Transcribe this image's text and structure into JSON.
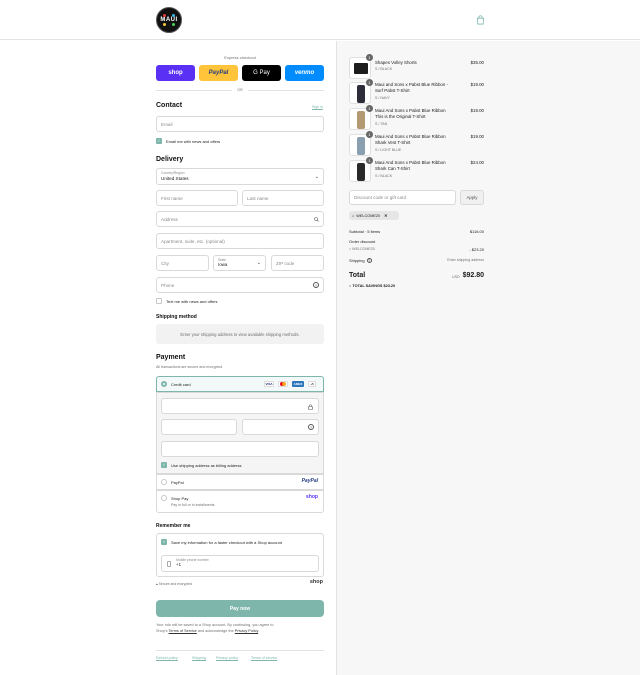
{
  "header": {
    "logo_text": "MAUI",
    "bag_icon": "shopping-bag-icon"
  },
  "express": {
    "title": "Express checkout",
    "shop_label": "shop",
    "paypal_label": "PayPal",
    "gpay_label": "G Pay",
    "venmo_label": "venmo",
    "or_label": "OR"
  },
  "contact": {
    "title": "Contact",
    "signin_label": "Sign in",
    "email_placeholder": "Email",
    "news_label": "Email me with news and offers"
  },
  "delivery": {
    "title": "Delivery",
    "country_label": "Country/Region",
    "country_value": "United States",
    "first_name_placeholder": "First name",
    "last_name_placeholder": "Last name",
    "address_placeholder": "Address",
    "apartment_placeholder": "Apartment, suite, etc. (optional)",
    "city_placeholder": "City",
    "state_label": "State",
    "state_value": "Iowa",
    "zip_placeholder": "ZIP code",
    "phone_placeholder": "Phone",
    "text_news_label": "Text me with news and offers"
  },
  "shipping": {
    "title": "Shipping method",
    "message": "Enter your shipping address to view available shipping methods."
  },
  "payment": {
    "title": "Payment",
    "subtitle": "All transactions are secure and encrypted.",
    "credit_card_label": "Credit card",
    "card_brands": [
      "VISA",
      "MC",
      "AMEX",
      "+5"
    ],
    "billing_label": "Use shipping address as billing address",
    "paypal_label": "PayPal",
    "paypal_logo": "PayPal",
    "shoppay_label": "Shop Pay",
    "shoppay_sub": "Pay in full or in installments",
    "shoppay_logo": "shop"
  },
  "remember": {
    "title": "Remember me",
    "save_label": "Save my information for a faster checkout with a Shop account",
    "phone_label": "Mobile phone number",
    "phone_value": "+1",
    "secure_label": "Secure and encrypted",
    "shop_logo": "shop"
  },
  "pay_button": "Pay now",
  "legal": {
    "line1": "Your info will be saved to a Shop account. By continuing, you agree to",
    "line2_prefix": "Shop's",
    "terms": "Terms of Service",
    "and_text": "and acknowledge the",
    "privacy": "Privacy Policy",
    "end": "."
  },
  "footer_links": [
    "Refund policy",
    "Shipping",
    "Privacy policy",
    "Terms of service"
  ],
  "summary": {
    "products": [
      {
        "qty": "1",
        "name": [
          "Shapes Volley Shorts"
        ],
        "variant": "S / BLACK",
        "price": "$35.00"
      },
      {
        "qty": "1",
        "name": [
          "Maui and Sons x Pabst Blue Ribbon -",
          "Surf Pabst T-Shirt"
        ],
        "variant": "S / NAVY",
        "price": "$19.00"
      },
      {
        "qty": "1",
        "name": [
          "Maui And Sons x Pabst Blue Ribbon",
          "This is the Original T-Shirt"
        ],
        "variant": "S / TAN",
        "price": "$19.00"
      },
      {
        "qty": "1",
        "name": [
          "Maui And Sons x Pabst Blue Ribbon",
          "Shark Vest T-Shirt"
        ],
        "variant": "S / LIGHT BLUE",
        "price": "$19.00"
      },
      {
        "qty": "1",
        "name": [
          "Maui And Sons x Pabst Blue Ribbon",
          "Shark Can T-Shirt"
        ],
        "variant": "S / BLACK",
        "price": "$24.00"
      }
    ],
    "discount_placeholder": "Discount code or gift card",
    "apply_label": "Apply",
    "code_tag": "WELCOME20",
    "subtotal_label": "Subtotal · 5 items",
    "subtotal_value": "$116.00",
    "order_discount_label": "Order discount",
    "discount_code": "WELCOME20",
    "discount_value": "- $23.20",
    "shipping_label": "Shipping",
    "shipping_value": "Enter shipping address",
    "total_label": "Total",
    "currency": "USD",
    "total_value": "$92.80",
    "savings_label": "TOTAL SAVINGS",
    "savings_value": "$23.20"
  },
  "colors": {
    "accent": "#7eb6ab",
    "shop_purple": "#5a31f4",
    "paypal_yellow": "#ffc439",
    "venmo_blue": "#008cff"
  }
}
